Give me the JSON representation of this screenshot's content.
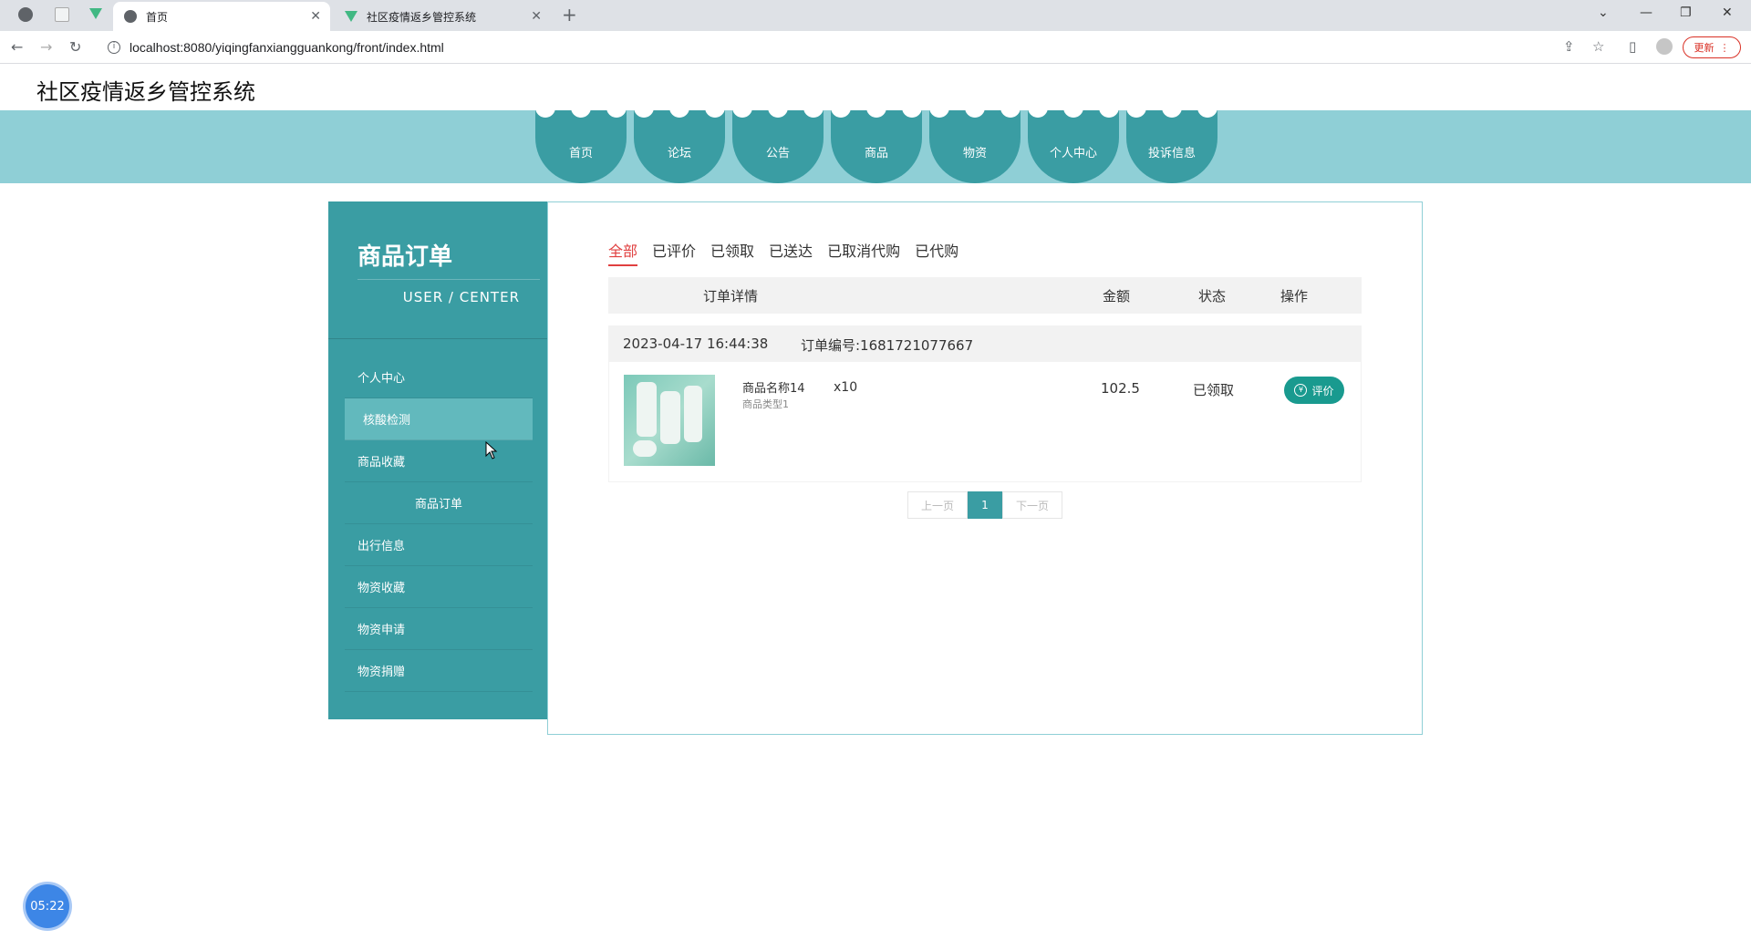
{
  "browser": {
    "tabs": [
      {
        "label": "首页",
        "active": true
      },
      {
        "label": "社区疫情返乡管控系统",
        "active": false
      }
    ],
    "url": "localhost:8080/yiqingfanxiangguankong/front/index.html",
    "update_label": "更新"
  },
  "site": {
    "title": "社区疫情返乡管控系统",
    "nav": [
      "首页",
      "论坛",
      "公告",
      "商品",
      "物资",
      "个人中心",
      "投诉信息"
    ]
  },
  "sidebar": {
    "title": "商品订单",
    "subtitle": "USER / CENTER",
    "items": [
      {
        "label": "个人中心"
      },
      {
        "label": "核酸检测"
      },
      {
        "label": "商品收藏"
      },
      {
        "label": "商品订单"
      },
      {
        "label": "出行信息"
      },
      {
        "label": "物资收藏"
      },
      {
        "label": "物资申请"
      },
      {
        "label": "物资捐赠"
      }
    ]
  },
  "orders": {
    "status_tabs": [
      "全部",
      "已评价",
      "已领取",
      "已送达",
      "已取消代购",
      "已代购"
    ],
    "active_tab": "全部",
    "columns": {
      "detail": "订单详情",
      "amount": "金额",
      "status": "状态",
      "action": "操作"
    },
    "items": [
      {
        "datetime": "2023-04-17 16:44:38",
        "order_no": "订单编号:1681721077667",
        "product_name": "商品名称14",
        "product_type": "商品类型1",
        "quantity": "x10",
        "amount": "102.5",
        "status": "已领取",
        "action_label": "评价"
      }
    ],
    "pager": {
      "prev": "上一页",
      "page": "1",
      "next": "下一页"
    }
  },
  "timer": "05:22"
}
